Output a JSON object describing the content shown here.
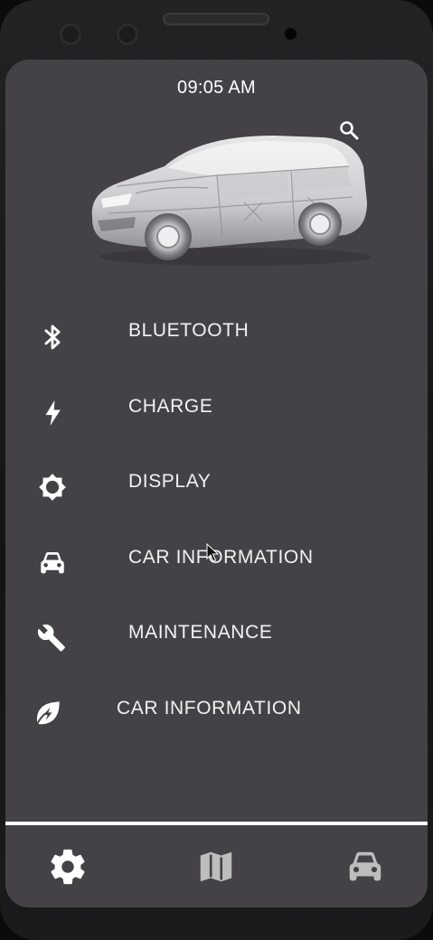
{
  "status_bar": {
    "time": "09:05 AM"
  },
  "menu": {
    "items": [
      {
        "label": "BLUETOOTH",
        "icon": "bluetooth-icon"
      },
      {
        "label": "CHARGE",
        "icon": "lightning-bolt-icon"
      },
      {
        "label": "DISPLAY",
        "icon": "brightness-gear-icon"
      },
      {
        "label": "CAR INFORMATION",
        "icon": "car-front-icon"
      },
      {
        "label": "MAINTENANCE",
        "icon": "wrench-icon"
      },
      {
        "label": "CAR INFORMATION",
        "icon": "eco-leaf-bolt-icon"
      }
    ]
  },
  "bottom_nav": {
    "items": [
      {
        "icon": "settings-gear-icon",
        "active": true
      },
      {
        "icon": "map-icon",
        "active": false
      },
      {
        "icon": "car-front-icon",
        "active": false
      }
    ]
  },
  "colors": {
    "screen_bg": "#444246",
    "text": "#f2f2f2",
    "icon_active": "#ffffff",
    "icon_inactive": "#bdbdbd"
  }
}
